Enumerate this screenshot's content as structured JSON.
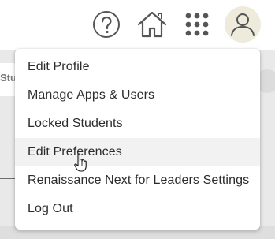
{
  "header": {
    "help_icon": "question-circle-icon",
    "home_icon": "home-icon",
    "apps_icon": "app-grid-icon",
    "user_icon": "user-account-icon"
  },
  "background": {
    "tab_label_partial": "Stu"
  },
  "user_menu": {
    "items": [
      {
        "label": "Edit Profile"
      },
      {
        "label": "Manage Apps & Users"
      },
      {
        "label": "Locked Students"
      },
      {
        "label": "Edit Preferences",
        "hovered": true
      },
      {
        "label": "Renaissance Next for Leaders Settings"
      },
      {
        "label": "Log Out"
      }
    ]
  },
  "colors": {
    "avatar_bg": "#efebdc",
    "icon_color": "#555555",
    "menu_hover_bg": "#f2f2f2",
    "menu_text": "#2c2c2c"
  },
  "cursor": {
    "type": "hand-pointer-icon"
  }
}
